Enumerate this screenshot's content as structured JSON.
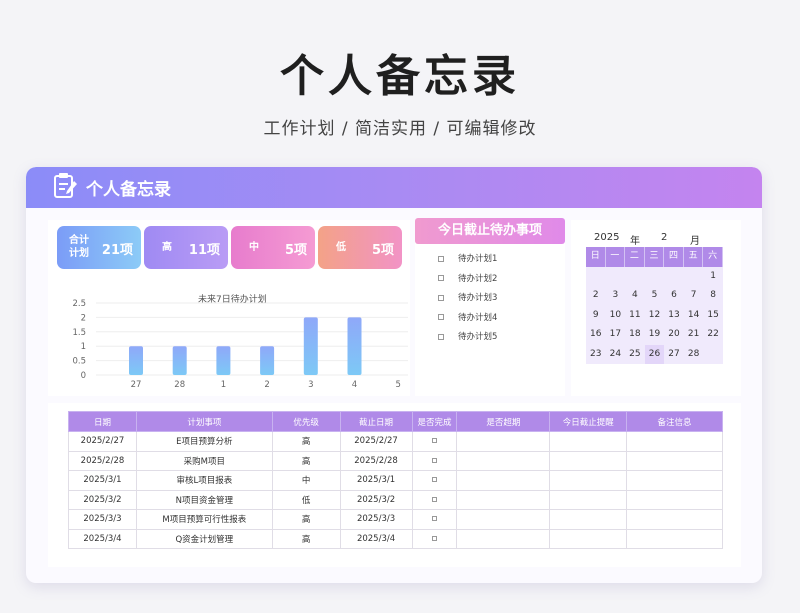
{
  "header": {
    "title": "个人备忘录",
    "subtitle": "工作计划 / 简洁实用 /  可编辑修改"
  },
  "banner": {
    "title": "个人备忘录",
    "icon": "notepad-icon"
  },
  "kpis": [
    {
      "label": "合计计划",
      "value": "21项",
      "color_from": "#7b9cf7",
      "color_to": "#8ccbf7"
    },
    {
      "label": "高",
      "value": "11项",
      "color_from": "#9f8af3",
      "color_to": "#b99cf5"
    },
    {
      "label": "中",
      "value": "5项",
      "color_from": "#e77ccd",
      "color_to": "#f59bd3"
    },
    {
      "label": "低",
      "value": "5项",
      "color_from": "#f3a287",
      "color_to": "#f293c6"
    }
  ],
  "chart_data": {
    "type": "bar",
    "title": "未来7日待办计划",
    "categories": [
      "27",
      "28",
      "1",
      "2",
      "3",
      "4",
      "5"
    ],
    "values": [
      1,
      1,
      1,
      1,
      2,
      2,
      0
    ],
    "ylim": [
      0,
      2.5
    ],
    "yticks": [
      "2.5",
      "2",
      "1.5",
      "1",
      "0.5",
      "0"
    ],
    "grid": true,
    "bar_color": "#8fa8f9"
  },
  "todo": {
    "title": "今日截止待办事项",
    "items": [
      "待办计划1",
      "待办计划2",
      "待办计划3",
      "待办计划4",
      "待办计划5"
    ]
  },
  "calendar": {
    "year": "2025",
    "year_label": "年",
    "month": "2",
    "month_label": "月",
    "weekdays": [
      "日",
      "一",
      "二",
      "三",
      "四",
      "五",
      "六"
    ],
    "weeks": [
      [
        "",
        "",
        "",
        "",
        "",
        "",
        "1"
      ],
      [
        "2",
        "3",
        "4",
        "5",
        "6",
        "7",
        "8"
      ],
      [
        "9",
        "10",
        "11",
        "12",
        "13",
        "14",
        "15"
      ],
      [
        "16",
        "17",
        "18",
        "19",
        "20",
        "21",
        "22"
      ],
      [
        "23",
        "24",
        "25",
        "26",
        "27",
        "28",
        ""
      ]
    ],
    "today": "26"
  },
  "table": {
    "headers": [
      "日期",
      "计划事项",
      "优先级",
      "截止日期",
      "是否完成",
      "是否超期",
      "今日截止提醒",
      "备注信息"
    ],
    "rows": [
      [
        "2025/2/27",
        "E项目预算分析",
        "高",
        "2025/2/27"
      ],
      [
        "2025/2/28",
        "采购M项目",
        "高",
        "2025/2/28"
      ],
      [
        "2025/3/1",
        "审核L项目报表",
        "中",
        "2025/3/1"
      ],
      [
        "2025/3/2",
        "N项目资金管理",
        "低",
        "2025/3/2"
      ],
      [
        "2025/3/3",
        "M项目预算可行性报表",
        "高",
        "2025/3/3"
      ],
      [
        "2025/3/4",
        "Q资金计划管理",
        "高",
        "2025/3/4"
      ]
    ]
  }
}
